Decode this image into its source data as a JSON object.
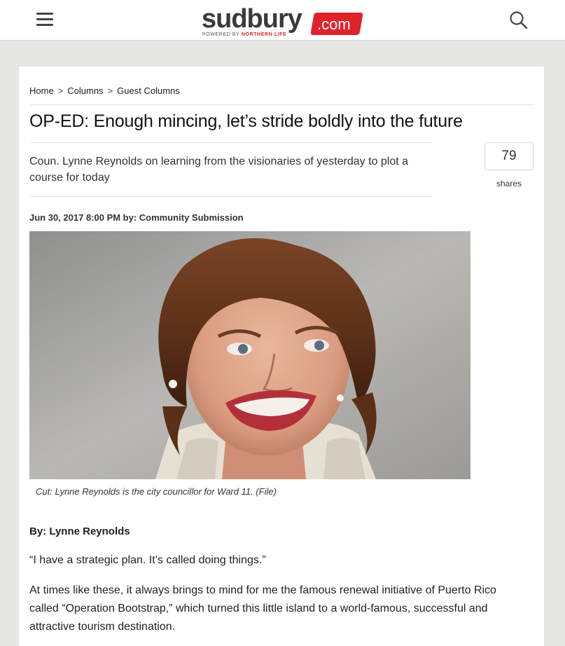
{
  "header": {
    "logo_word": "sudbury",
    "logo_badge": ".com",
    "logo_tag_prefix": "POWERED BY",
    "logo_tag_brand": "NORTHERN LIFE",
    "accent_color": "#e0232b"
  },
  "icons": {
    "menu": "hamburger-menu-icon",
    "search": "search-icon"
  },
  "breadcrumb": {
    "items": [
      "Home",
      "Columns",
      "Guest Columns"
    ],
    "separator": ">"
  },
  "article": {
    "headline": "OP-ED: Enough mincing, let’s stride boldly into the future",
    "subhead": "Coun. Lynne Reynolds on learning from the visionaries of yesterday to plot a course for today",
    "share_count": "79",
    "share_label": "shares",
    "dateline": "Jun 30, 2017 8:00 PM by: Community Submission",
    "photo_caption": "Cut: Lynne Reynolds is the city councillor for Ward 11. (File)",
    "byline": "By: Lynne Reynolds",
    "paragraphs": [
      "“I have a strategic plan. It’s called doing things.”",
      "At times like these, it always brings to mind for me the famous renewal initiative of Puerto Rico called “Operation Bootstrap,” which turned this little island to a world-famous, successful and attractive tourism destination."
    ]
  }
}
